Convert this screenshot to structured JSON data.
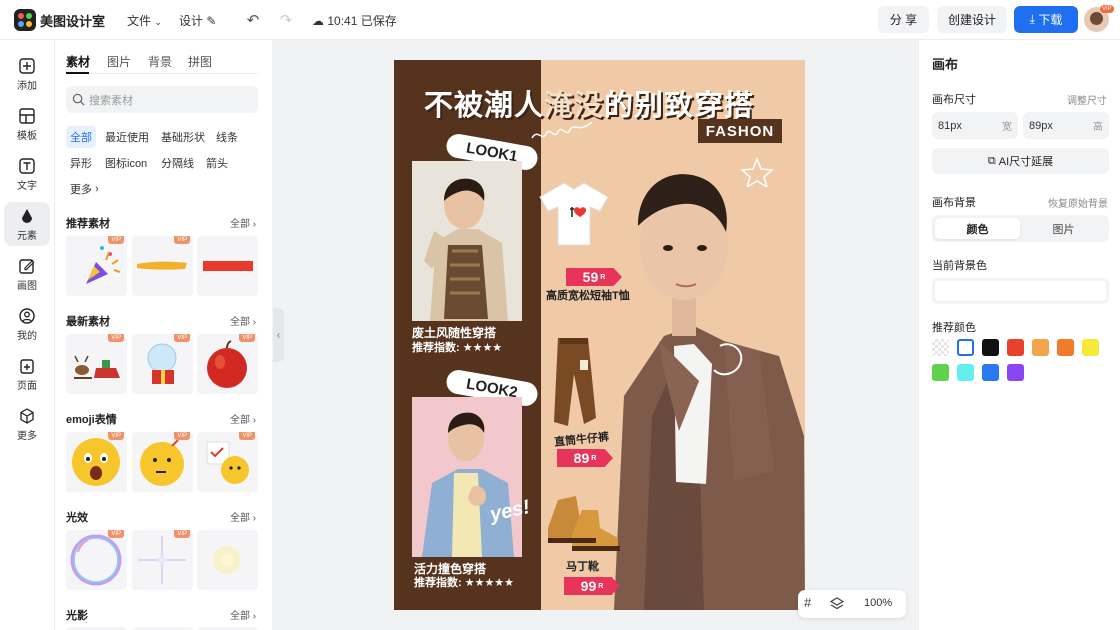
{
  "header": {
    "app_name": "美图设计室",
    "file_menu": "文件",
    "design_menu": "设计",
    "save_status": "10:41 已保存",
    "share_label": "分 享",
    "create_label": "创建设计",
    "download_label": "下载",
    "vip_badge": "VIP"
  },
  "rail": [
    {
      "label": "添加",
      "icon": "plus-square-icon"
    },
    {
      "label": "模板",
      "icon": "template-icon"
    },
    {
      "label": "文字",
      "icon": "text-icon"
    },
    {
      "label": "元素",
      "icon": "shapes-icon"
    },
    {
      "label": "画图",
      "icon": "edit-icon"
    },
    {
      "label": "我的",
      "icon": "user-icon"
    },
    {
      "label": "页面",
      "icon": "add-page-icon"
    },
    {
      "label": "更多",
      "icon": "cube-icon"
    }
  ],
  "panel": {
    "tabs": [
      "素材",
      "图片",
      "背景",
      "拼图"
    ],
    "search_placeholder": "搜索素材",
    "chips": [
      "全部",
      "最近使用",
      "基础形状",
      "线条",
      "异形",
      "图标icon",
      "分隔线",
      "箭头",
      "更多"
    ],
    "sections": [
      {
        "title": "推荐素材",
        "all": "全部"
      },
      {
        "title": "最新素材",
        "all": "全部"
      },
      {
        "title": "emoji表情",
        "all": "全部"
      },
      {
        "title": "光效",
        "all": "全部"
      },
      {
        "title": "光影",
        "all": "全部"
      }
    ],
    "vip": "VIP"
  },
  "canvas": {
    "title_white": "不被潮人",
    "title_brown": "淹没",
    "title_white2": "的",
    "title_brown2": "别致穿搭",
    "fashion": "FASHON",
    "look1": "LOOK1",
    "look2": "LOOK2",
    "look1_name": "废土风随性穿搭",
    "look1_rating": "推荐指数: ★★★★",
    "look2_name": "活力撞色穿搭",
    "look2_rating": "推荐指数: ★★★★★",
    "yes": "yes!",
    "products": [
      {
        "price": "59",
        "unit": "R",
        "name": "高质宽松短袖T恤"
      },
      {
        "price": "89",
        "unit": "R",
        "name": "直筒牛仔裤"
      },
      {
        "price": "99",
        "unit": "R",
        "name": "马丁靴"
      }
    ]
  },
  "right": {
    "title": "画布",
    "size_label": "画布尺寸",
    "adjust_size": "调整尺寸",
    "width_value": "81px",
    "width_unit": "宽",
    "height_value": "89px",
    "height_unit": "高",
    "ai_extend": "AI尺寸延展",
    "bg_label": "画布背景",
    "restore_bg": "恢复原始背景",
    "seg_color": "颜色",
    "seg_image": "图片",
    "current_bg": "当前背景色",
    "recommended": "推荐颜色",
    "swatches": [
      "transparent",
      "#ffffff",
      "#111111",
      "#e8412c",
      "#f2a54a",
      "#f07c2a",
      "#f7e93a",
      "#5fd14a",
      "#64eef0",
      "#2b79f0",
      "#8a46f0"
    ]
  },
  "zoom": {
    "value": "100%"
  }
}
